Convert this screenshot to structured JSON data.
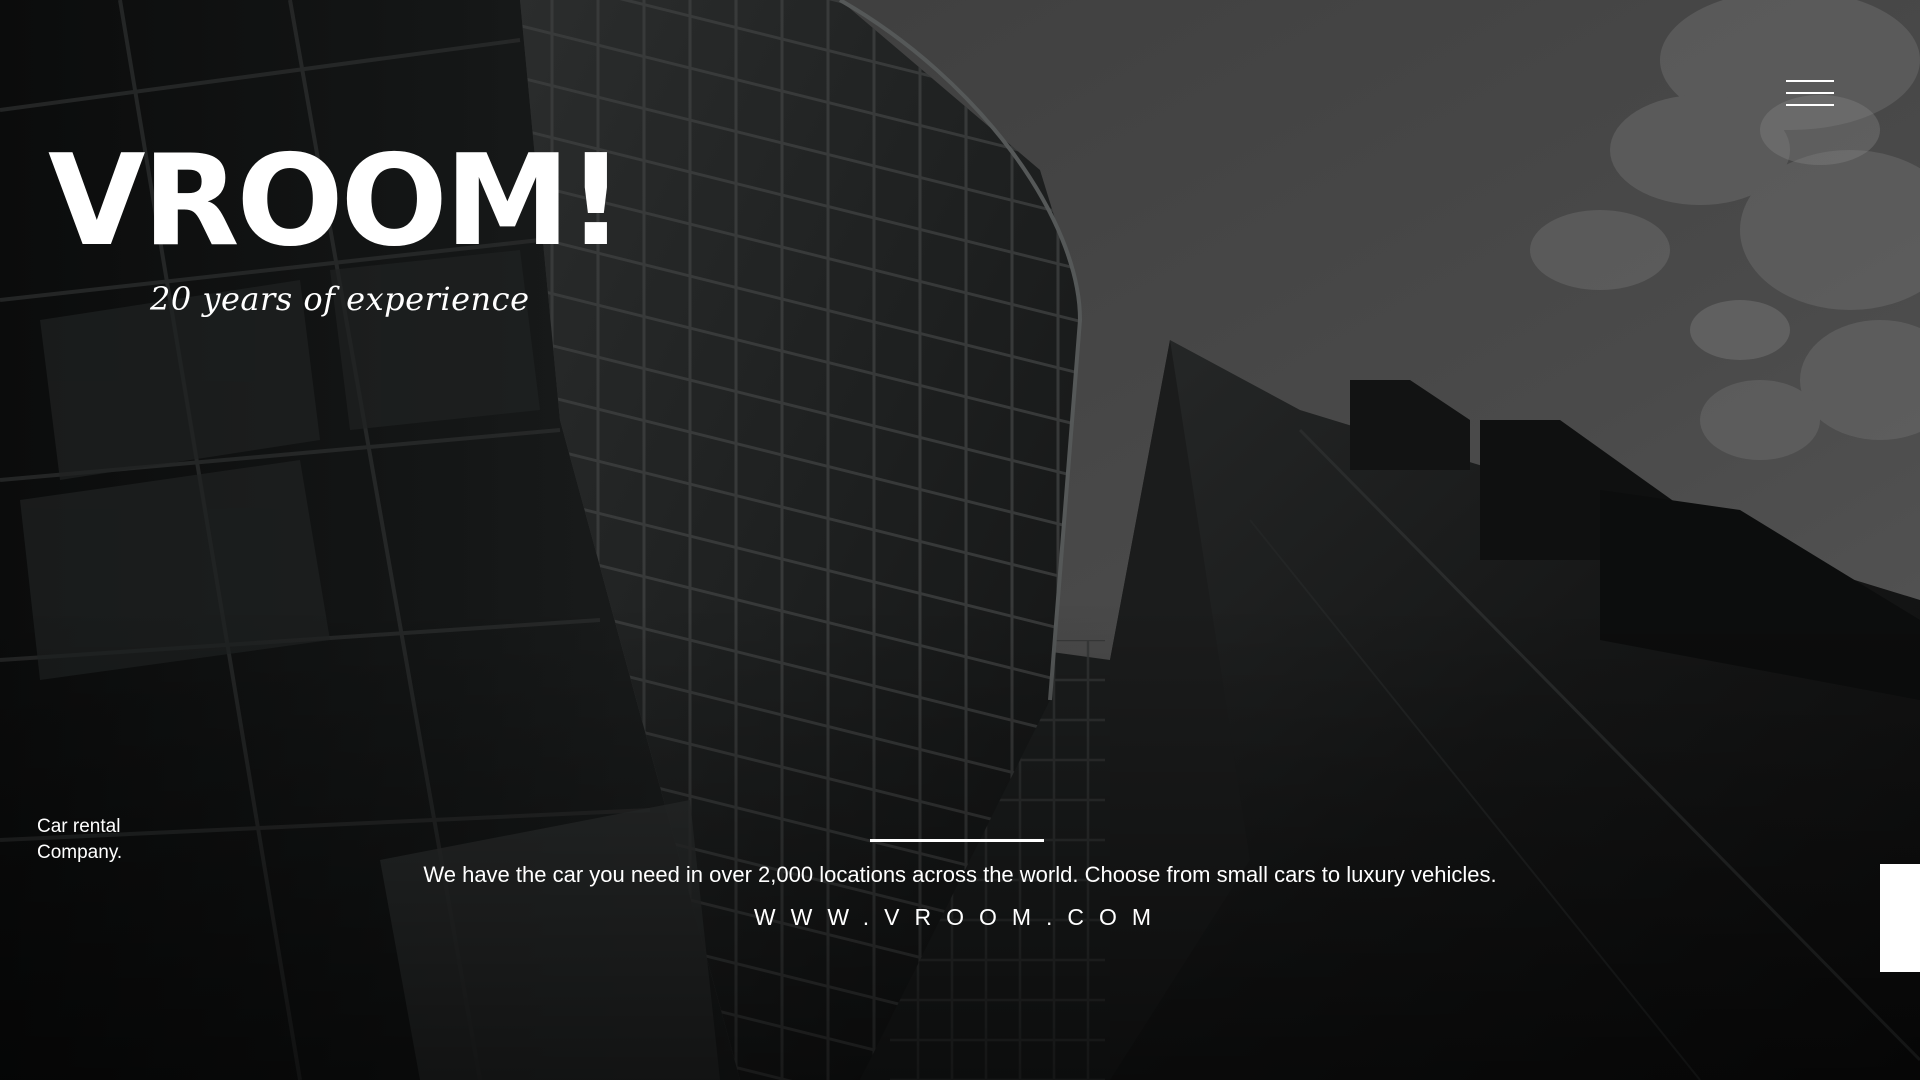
{
  "hero": {
    "title": "VROOM!",
    "tagline": "20 years of experience",
    "company_label": "Car rental Company.",
    "description": "We have the car you need in over 2,000 locations across the world. Choose from small cars to luxury vehicles.",
    "website": "WWW.VROOM.COM"
  },
  "menu": {
    "icon": "hamburger-menu-icon"
  },
  "colors": {
    "text": "#ffffff",
    "background": "#0e0f0f",
    "sky": "#4a4a4a"
  }
}
